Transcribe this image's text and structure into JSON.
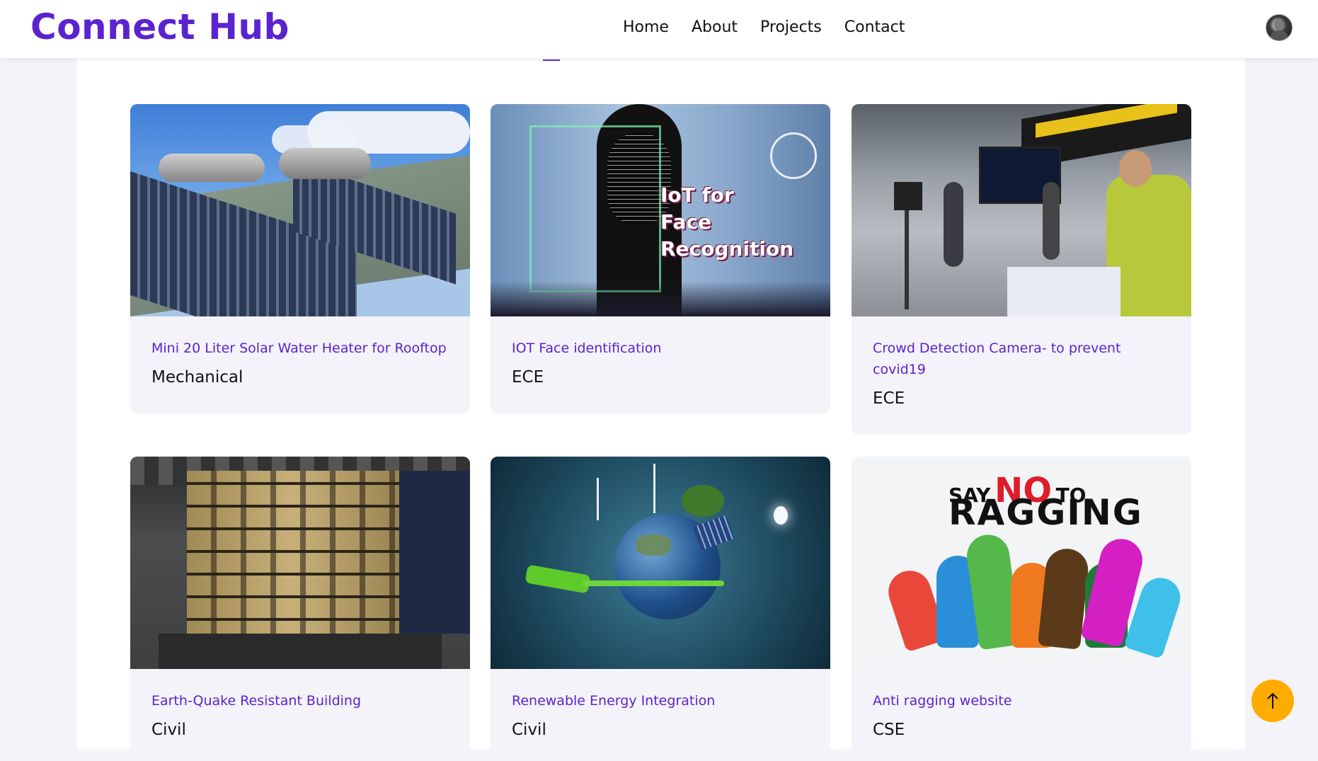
{
  "navbar": {
    "brand": "Connect Hub",
    "links": [
      "Home",
      "About",
      "Projects",
      "Contact"
    ]
  },
  "projects": [
    {
      "title": "Mini 20 Liter Solar Water Heater for Rooftop",
      "dept": "Mechanical",
      "image": "solar-water-heater-image"
    },
    {
      "title": "IOT Face identification",
      "dept": "ECE",
      "image": "iot-face-recognition-image",
      "image_text": [
        "IoT for",
        "Face Recognition"
      ]
    },
    {
      "title": "Crowd Detection Camera- to prevent covid19",
      "dept": "ECE",
      "image": "crowd-detection-camera-image"
    },
    {
      "title": "Earth-Quake Resistant Building",
      "dept": "Civil",
      "image": "earthquake-building-image"
    },
    {
      "title": "Renewable Energy Integration",
      "dept": "Civil",
      "image": "renewable-energy-earth-image"
    },
    {
      "title": "Anti ragging website",
      "dept": "CSE",
      "image": "say-no-to-ragging-image",
      "image_text": [
        "SAY",
        "NO",
        "TO",
        "RAGGING"
      ]
    }
  ],
  "colors": {
    "brand": "#5b23cf",
    "page_bg": "#f4f3f9",
    "scroll_button": "#ffab00"
  },
  "icons": {
    "scroll_top": "arrow-up-icon",
    "avatar": "user-avatar"
  }
}
